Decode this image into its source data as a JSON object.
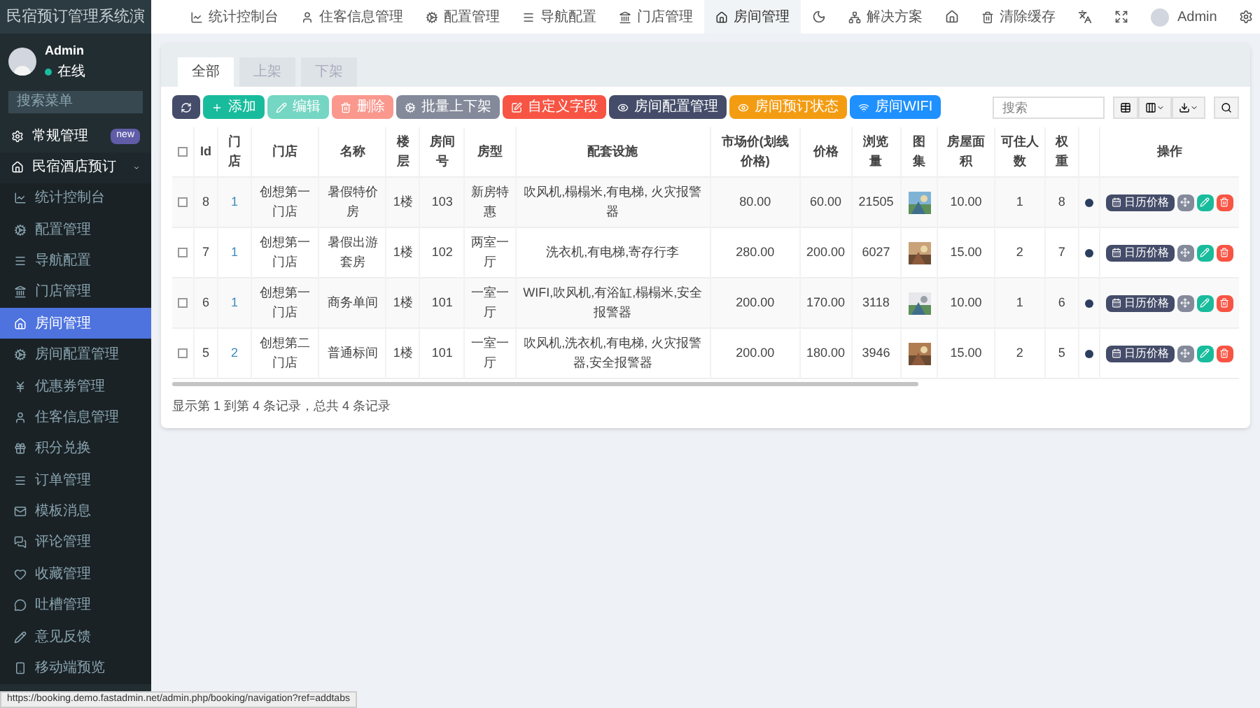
{
  "sidebar": {
    "title": "民宿预订管理系统演",
    "user": {
      "name": "Admin",
      "status": "在线"
    },
    "search": {
      "placeholder": "搜索菜单"
    },
    "items": [
      {
        "label": "常规管理",
        "badge": "new"
      },
      {
        "label": "民宿酒店预订",
        "expanded": true,
        "children": [
          {
            "label": "统计控制台",
            "selected": false
          },
          {
            "label": "配置管理",
            "selected": false
          },
          {
            "label": "导航配置",
            "selected": false
          },
          {
            "label": "门店管理",
            "selected": false
          },
          {
            "label": "房间管理",
            "selected": true
          },
          {
            "label": "房间配置管理",
            "selected": false
          },
          {
            "label": "优惠券管理",
            "selected": false
          },
          {
            "label": "住客信息管理",
            "selected": false
          },
          {
            "label": "积分兑换",
            "selected": false
          },
          {
            "label": "订单管理",
            "selected": false
          },
          {
            "label": "模板消息",
            "selected": false
          },
          {
            "label": "评论管理",
            "selected": false
          },
          {
            "label": "收藏管理",
            "selected": false
          },
          {
            "label": "吐槽管理",
            "selected": false
          },
          {
            "label": "意见反馈",
            "selected": false
          },
          {
            "label": "移动端预览",
            "selected": false
          }
        ]
      }
    ]
  },
  "topbar": {
    "tabs": [
      {
        "label": "统计控制台",
        "selected": false
      },
      {
        "label": "住客信息管理",
        "selected": false
      },
      {
        "label": "配置管理",
        "selected": false
      },
      {
        "label": "导航配置",
        "selected": false
      },
      {
        "label": "门店管理",
        "selected": false
      },
      {
        "label": "房间管理",
        "selected": true
      }
    ],
    "links": [
      "解决方案",
      "清除缓存"
    ],
    "user": "Admin"
  },
  "filter_tabs": [
    {
      "label": "全部",
      "selected": true
    },
    {
      "label": "上架",
      "selected": false
    },
    {
      "label": "下架",
      "selected": false
    }
  ],
  "toolbar": [
    {
      "label": "添加",
      "disabled": false
    },
    {
      "label": "编辑",
      "disabled": true
    },
    {
      "label": "删除",
      "disabled": true
    },
    {
      "label": "批量上下架",
      "disabled": false
    },
    {
      "label": "自定义字段",
      "disabled": false
    },
    {
      "label": "房间配置管理",
      "disabled": false
    },
    {
      "label": "房间预订状态",
      "disabled": false
    },
    {
      "label": "房间WIFI",
      "disabled": false
    }
  ],
  "search": {
    "placeholder": "搜索"
  },
  "table": {
    "select_all": {
      "checked": false
    },
    "columns": [
      "Id",
      "门店",
      "门店",
      "名称",
      "楼层",
      "房间号",
      "房型",
      "配套设施",
      "市场价(划线价格)",
      "价格",
      "浏览量",
      "图集",
      "房屋面积",
      "可住人数",
      "权重",
      "",
      "操作"
    ],
    "rows": [
      {
        "checked": false,
        "cells": [
          "8",
          "1",
          "创想第一门店",
          "暑假特价房",
          "1楼",
          "103",
          "新房特惠",
          "吹风机,榻榻米,有电梯, 火灾报警器",
          "80.00",
          "60.00",
          "21505",
          "",
          "10.00",
          "1",
          "8"
        ],
        "action": "日历价格"
      },
      {
        "checked": false,
        "cells": [
          "7",
          "1",
          "创想第一门店",
          "暑假出游套房",
          "1楼",
          "102",
          "两室一厅",
          "洗衣机,有电梯,寄存行李",
          "280.00",
          "200.00",
          "6027",
          "",
          "15.00",
          "2",
          "7"
        ],
        "action": "日历价格"
      },
      {
        "checked": false,
        "cells": [
          "6",
          "1",
          "创想第一门店",
          "商务单间",
          "1楼",
          "101",
          "一室一厅",
          "WIFI,吹风机,有浴缸,榻榻米,安全报警器",
          "200.00",
          "170.00",
          "3118",
          "",
          "10.00",
          "1",
          "6"
        ],
        "action": "日历价格"
      },
      {
        "checked": false,
        "cells": [
          "5",
          "2",
          "创想第二门店",
          "普通标间",
          "1楼",
          "101",
          "一室一厅",
          "吹风机,洗衣机,有电梯, 火灾报警器,安全报警器",
          "200.00",
          "180.00",
          "3946",
          "",
          "15.00",
          "2",
          "5"
        ],
        "action": "日历价格"
      }
    ]
  },
  "pagination_info": "显示第 1 到第 4 条记录，总共 4 条记录",
  "status_bar": "https://booking.demo.fastadmin.net/admin.php/booking/navigation?ref=addtabs"
}
